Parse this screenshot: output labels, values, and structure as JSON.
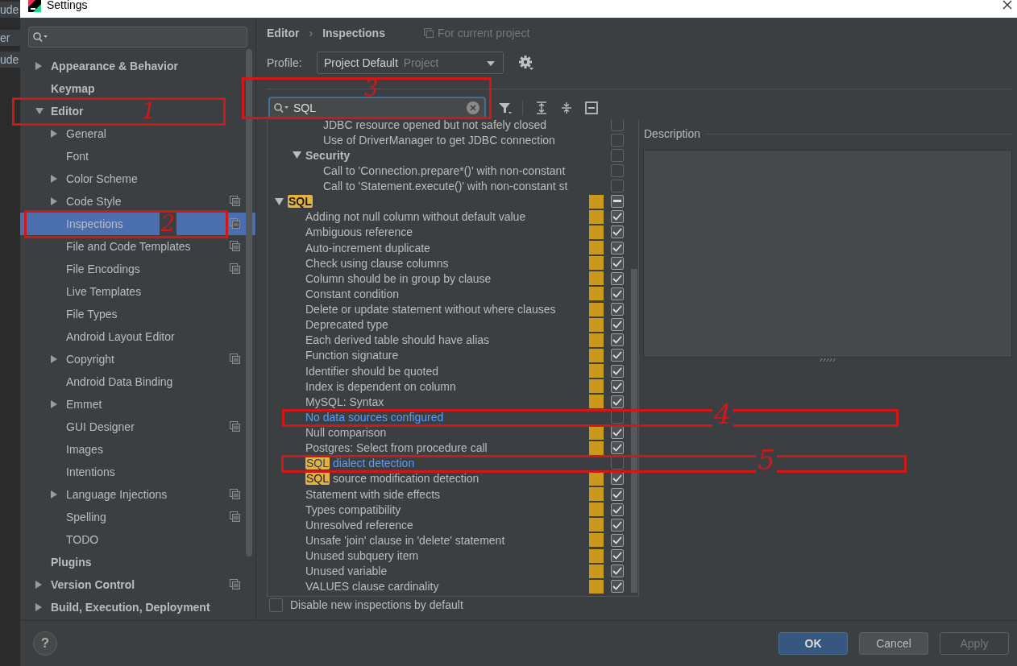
{
  "background_window": {
    "texts": [
      "ude",
      "er",
      "ude"
    ]
  },
  "window": {
    "title": "Settings"
  },
  "sidebar": {
    "items": [
      {
        "label": "Appearance & Behavior",
        "expanded": false,
        "project_scope": false,
        "selected": false
      },
      {
        "label": "Keymap",
        "project_scope": false,
        "selected": false
      },
      {
        "label": "Editor",
        "expanded": true,
        "project_scope": false,
        "selected": false,
        "children": [
          {
            "label": "General",
            "expanded": false,
            "project_scope": false,
            "selected": false
          },
          {
            "label": "Font",
            "project_scope": false,
            "selected": false
          },
          {
            "label": "Color Scheme",
            "expanded": false,
            "project_scope": false,
            "selected": false
          },
          {
            "label": "Code Style",
            "expanded": false,
            "project_scope": true,
            "selected": false
          },
          {
            "label": "Inspections",
            "project_scope": true,
            "selected": true
          },
          {
            "label": "File and Code Templates",
            "project_scope": true,
            "selected": false
          },
          {
            "label": "File Encodings",
            "project_scope": true,
            "selected": false
          },
          {
            "label": "Live Templates",
            "project_scope": false,
            "selected": false
          },
          {
            "label": "File Types",
            "project_scope": false,
            "selected": false
          },
          {
            "label": "Android Layout Editor",
            "project_scope": false,
            "selected": false
          },
          {
            "label": "Copyright",
            "expanded": false,
            "project_scope": true,
            "selected": false
          },
          {
            "label": "Android Data Binding",
            "project_scope": false,
            "selected": false
          },
          {
            "label": "Emmet",
            "expanded": false,
            "project_scope": false,
            "selected": false
          },
          {
            "label": "GUI Designer",
            "project_scope": true,
            "selected": false
          },
          {
            "label": "Images",
            "project_scope": false,
            "selected": false
          },
          {
            "label": "Intentions",
            "project_scope": false,
            "selected": false
          },
          {
            "label": "Language Injections",
            "expanded": false,
            "project_scope": true,
            "selected": false
          },
          {
            "label": "Spelling",
            "project_scope": true,
            "selected": false
          },
          {
            "label": "TODO",
            "project_scope": false,
            "selected": false
          }
        ]
      },
      {
        "label": "Plugins",
        "project_scope": false,
        "selected": false
      },
      {
        "label": "Version Control",
        "expanded": false,
        "project_scope": true,
        "selected": false
      },
      {
        "label": "Build, Execution, Deployment",
        "expanded": false,
        "project_scope": false,
        "selected": false
      }
    ]
  },
  "breadcrumb": {
    "parent": "Editor",
    "separator": "›",
    "current": "Inspections",
    "scope": "For current project"
  },
  "profile": {
    "label": "Profile:",
    "value": "Project Default",
    "scope": "Project"
  },
  "filter": {
    "value": "SQL"
  },
  "inspections": {
    "tree": [
      {
        "children": [
          {
            "children": [
              {
                "text": "JDBC resource opened but not safely closed",
                "warning": false,
                "checked": false,
                "partial": false,
                "modified": false
              },
              {
                "text": "Use of DriverManager to get JDBC connection",
                "warning": false,
                "checked": false,
                "partial": false,
                "modified": false
              }
            ]
          },
          {
            "text": "Security",
            "expanded": true,
            "warning": false,
            "checked": false,
            "partial": false,
            "modified": false,
            "children": [
              {
                "text": "Call to 'Connection.prepare*()' with non-constant",
                "warning": false,
                "checked": false,
                "partial": false,
                "modified": false
              },
              {
                "text": "Call to 'Statement.execute()' with non-constant st",
                "warning": false,
                "checked": false,
                "partial": false,
                "modified": false
              }
            ]
          }
        ]
      },
      {
        "match": "SQL",
        "expanded": true,
        "warning": true,
        "checked": true,
        "partial": true,
        "modified": false,
        "children": [
          {
            "text": "Adding not null column without default value",
            "warning": true,
            "checked": true,
            "partial": false,
            "modified": false
          },
          {
            "text": "Ambiguous reference",
            "warning": true,
            "checked": true,
            "partial": false,
            "modified": false
          },
          {
            "text": "Auto-increment duplicate",
            "warning": true,
            "checked": true,
            "partial": false,
            "modified": false
          },
          {
            "text": "Check using clause columns",
            "warning": true,
            "checked": true,
            "partial": false,
            "modified": false
          },
          {
            "text": "Column should be in group by clause",
            "warning": true,
            "checked": true,
            "partial": false,
            "modified": false
          },
          {
            "text": "Constant condition",
            "warning": true,
            "checked": true,
            "partial": false,
            "modified": false
          },
          {
            "text": "Delete or update statement without where clauses",
            "warning": true,
            "checked": true,
            "partial": false,
            "modified": false
          },
          {
            "text": "Deprecated type",
            "warning": true,
            "checked": true,
            "partial": false,
            "modified": false
          },
          {
            "text": "Each derived table should have alias",
            "warning": true,
            "checked": true,
            "partial": false,
            "modified": false
          },
          {
            "text": "Function signature",
            "warning": true,
            "checked": true,
            "partial": false,
            "modified": false
          },
          {
            "text": "Identifier should be quoted",
            "warning": true,
            "checked": true,
            "partial": false,
            "modified": false
          },
          {
            "text": "Index is dependent on column",
            "warning": true,
            "checked": true,
            "partial": false,
            "modified": false
          },
          {
            "text": "MySQL: Syntax",
            "warning": true,
            "checked": true,
            "partial": false,
            "modified": false
          },
          {
            "text": "No data sources configured",
            "warning": false,
            "checked": false,
            "partial": false,
            "modified": true
          },
          {
            "text": "Null comparison",
            "warning": true,
            "checked": true,
            "partial": false,
            "modified": false
          },
          {
            "text": "Postgres: Select from procedure call",
            "warning": true,
            "checked": true,
            "partial": false,
            "modified": false
          },
          {
            "match": "SQL",
            "text": "dialect detection",
            "warning": false,
            "checked": false,
            "partial": false,
            "modified": true
          },
          {
            "match": "SQL",
            "text": "source modification detection",
            "warning": true,
            "checked": true,
            "partial": false,
            "modified": false
          },
          {
            "text": "Statement with side effects",
            "warning": true,
            "checked": true,
            "partial": false,
            "modified": false
          },
          {
            "text": "Types compatibility",
            "warning": true,
            "checked": true,
            "partial": false,
            "modified": false
          },
          {
            "text": "Unresolved reference",
            "warning": true,
            "checked": true,
            "partial": false,
            "modified": false
          },
          {
            "text": "Unsafe 'join' clause in 'delete' statement",
            "warning": true,
            "checked": true,
            "partial": false,
            "modified": false
          },
          {
            "text": "Unused subquery item",
            "warning": true,
            "checked": true,
            "partial": false,
            "modified": false
          },
          {
            "text": "Unused variable",
            "warning": true,
            "checked": true,
            "partial": false,
            "modified": false
          },
          {
            "text": "VALUES clause cardinality",
            "warning": true,
            "checked": true,
            "partial": false,
            "modified": false
          }
        ]
      }
    ]
  },
  "description": {
    "title": "Description"
  },
  "disable_new": {
    "label": "Disable new inspections by default",
    "checked": false
  },
  "help": "?",
  "buttons": [
    {
      "label": "OK",
      "kind": "primary"
    },
    {
      "label": "Cancel",
      "kind": "normal"
    },
    {
      "label": "Apply",
      "kind": "disabled"
    }
  ],
  "annotations": [
    {
      "label": "1"
    },
    {
      "label": "2"
    },
    {
      "label": "3"
    },
    {
      "label": "4"
    },
    {
      "label": "5"
    }
  ]
}
